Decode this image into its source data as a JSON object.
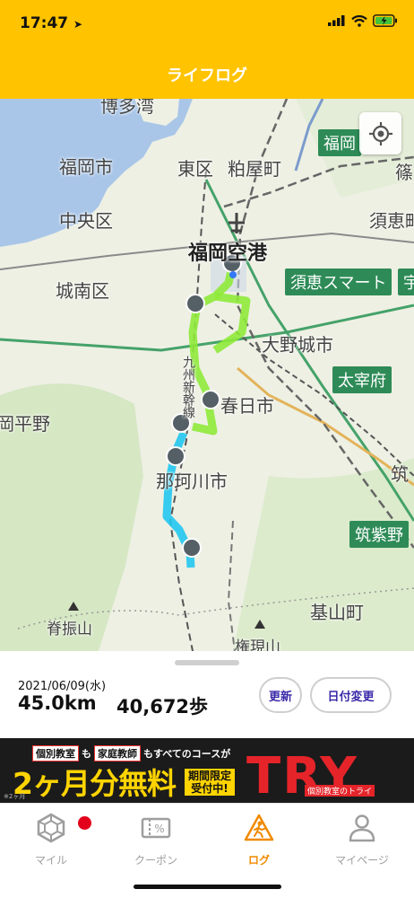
{
  "status_bar": {
    "time": "17:47",
    "location_arrow": "location-arrow-icon",
    "battery_charging": true
  },
  "header": {
    "title": "ライフログ",
    "bg_color": "#FFC300"
  },
  "map": {
    "labels": {
      "fukuoka_city": "福岡市",
      "higashi_ku": "東区",
      "kasuya": "粕屋町",
      "chuo_ku": "中央区",
      "jonan_ku": "城南区",
      "airport": "福岡空港",
      "sue": "須恵町",
      "onojo": "大野城市",
      "kasuga": "春日市",
      "nakagawa": "那珂川市",
      "hiraoka": "岡平野",
      "sefurisan": "脊振山",
      "kizan": "基山町",
      "gongen": "権現山",
      "shinkansen": "九州新幹線",
      "harbor": "博多湾",
      "sasaguri": "篠"
    },
    "signs": {
      "fukuoka": "福岡",
      "sue_smart": "須恵スマート",
      "u": "宇",
      "dazaifu": "太宰府",
      "chikushino": "筑紫野",
      "chiku": "筑"
    },
    "route_colors": {
      "green": "#8EEA3A",
      "cyan": "#22C7F0"
    }
  },
  "info": {
    "date": "2021/06/09(水)",
    "distance": "45.0km",
    "steps": "40,672歩",
    "refresh_label": "更新",
    "change_date_label": "日付変更"
  },
  "ad": {
    "badge1": "個別教室",
    "mo1": "も",
    "badge2": "家庭教師",
    "rest": "もすべてのコースが",
    "main": "2ヶ月分無料",
    "limited": "期間限定\n受付中!",
    "brand": "TRY",
    "caption": "個別教室のトライ",
    "footnote": "※2ヶ月"
  },
  "tabs": [
    {
      "label": "マイル",
      "icon": "hexagon-icon",
      "active": false,
      "badge": true
    },
    {
      "label": "クーポン",
      "icon": "coupon-icon",
      "active": false
    },
    {
      "label": "ログ",
      "icon": "walker-icon",
      "active": true
    },
    {
      "label": "マイページ",
      "icon": "person-icon",
      "active": false
    }
  ]
}
